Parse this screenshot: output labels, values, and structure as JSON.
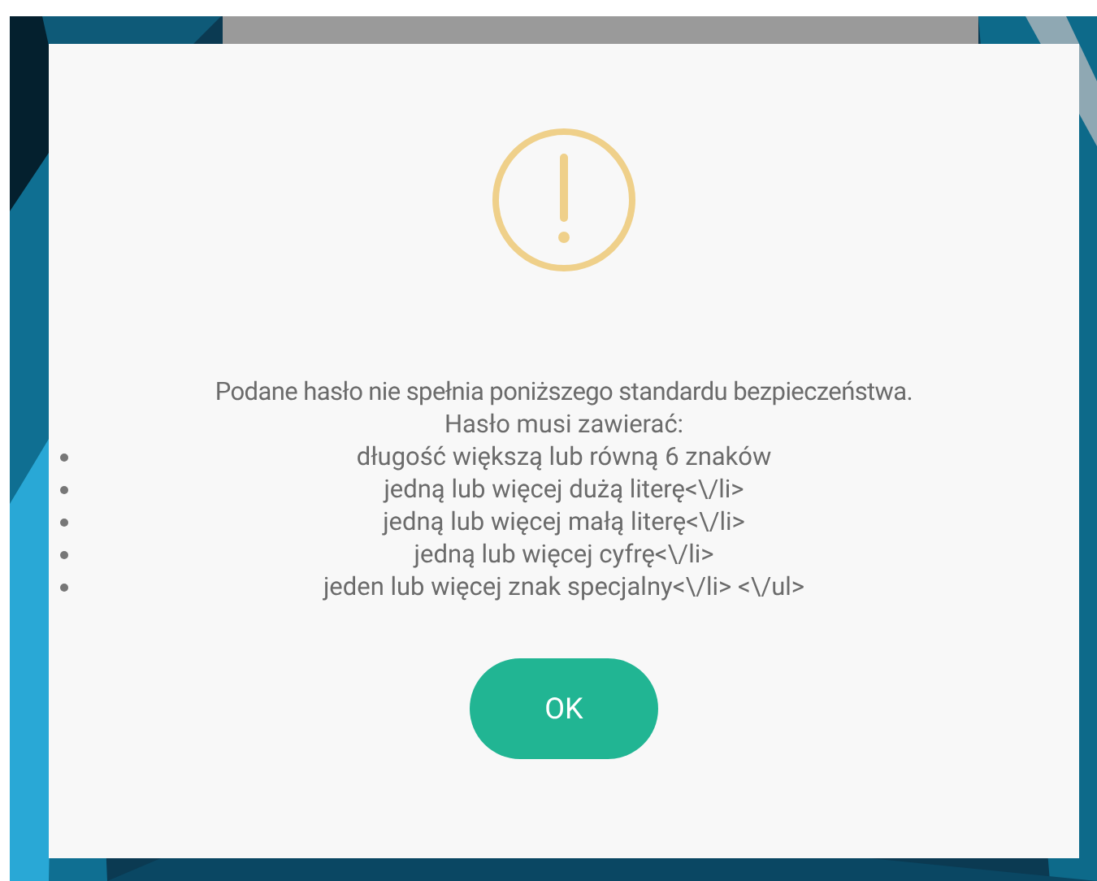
{
  "dialog": {
    "message": "Podane hasło nie spełnia poniższego standardu bezpieczeństwa.",
    "subtitle": "Hasło musi zawierać:",
    "requirements": [
      "długość większą lub równą 6 znaków",
      "jedną lub więcej dużą literę<\\/li>",
      "jedną lub więcej małą literę<\\/li>",
      "jedną lub więcej cyfrę<\\/li>",
      "jeden lub więcej znak specjalny<\\/li> <\\/ul>"
    ],
    "button": "OK"
  }
}
